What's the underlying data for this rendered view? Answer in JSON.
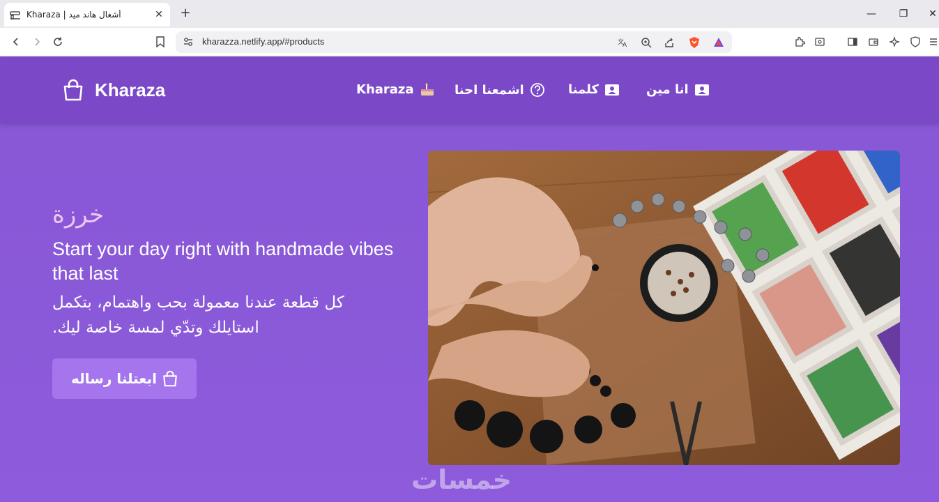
{
  "browser": {
    "tab_title": "Kharaza | أشغال هاند ميد",
    "url": "kharazza.netlify.app/#products",
    "new_tab_label": "+"
  },
  "nav": {
    "brand": "Kharaza",
    "links": [
      {
        "label": "Kharaza",
        "icon": "cake-emoji-icon"
      },
      {
        "label": "اشمعنا احنا",
        "icon": "question-circle-icon"
      },
      {
        "label": "كلمنا",
        "icon": "contact-card-icon"
      },
      {
        "label": "انا مين",
        "icon": "contact-card-icon"
      }
    ]
  },
  "hero": {
    "ar_title": "خرزة",
    "en_title": "Start your day right with handmade vibes that last",
    "ar_desc": "كل قطعة عندنا معمولة بحب واهتمام، بتكمل استايلك وتدّي لمسة خاصة ليك.",
    "cta_label": "ابعتلنا رساله"
  },
  "watermark": "خمسات",
  "colors": {
    "navbar": "#7b48c8",
    "page": "#8a5ad6",
    "cta": "#a475ec",
    "title_pink": "#f0c7f3"
  }
}
